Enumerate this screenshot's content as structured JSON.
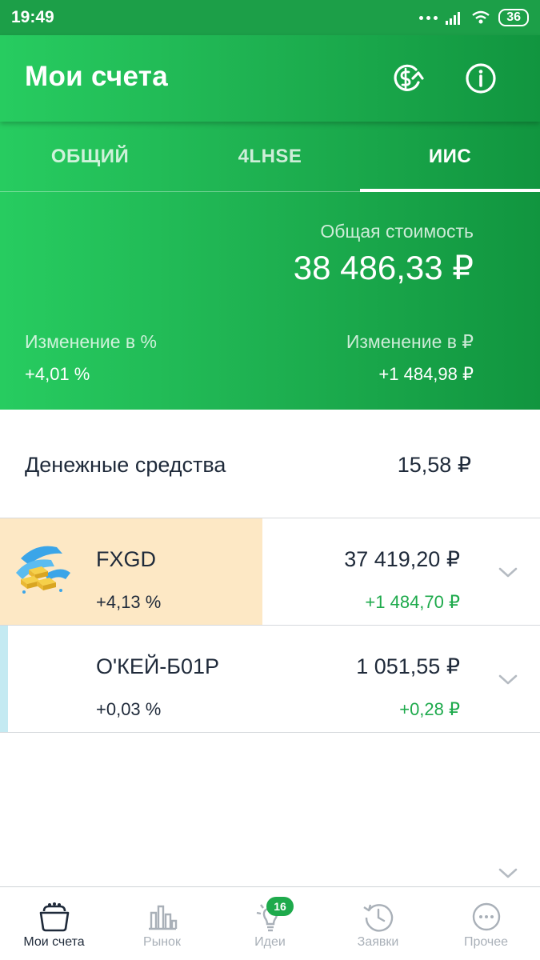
{
  "status_bar": {
    "time": "19:49",
    "battery": "36"
  },
  "header": {
    "title": "Мои счета",
    "icons": [
      "currency-exchange-icon",
      "info-icon"
    ]
  },
  "tabs": [
    {
      "label": "ОБЩИЙ",
      "selected": false
    },
    {
      "label": "4LHSE",
      "selected": false
    },
    {
      "label": "ИИС",
      "selected": true
    }
  ],
  "summary": {
    "total_label": "Общая стоимость",
    "total_value": "38 486,33 ₽",
    "change_pct_label": "Изменение в  %",
    "change_pct_value": "+4,01  %",
    "change_rub_label": "Изменение в ₽",
    "change_rub_value": "+1 484,98 ₽"
  },
  "cash": {
    "label": "Денежные средства",
    "value": "15,58 ₽"
  },
  "assets": [
    {
      "name": "FXGD",
      "pct": "+4,13  %",
      "value": "37 419,20 ₽",
      "change": "+1 484,70 ₽",
      "share": 0.486
    },
    {
      "name": "О'КЕЙ-Б01Р",
      "pct": "+0,03  %",
      "value": "1 051,55 ₽",
      "change": "+0,28 ₽",
      "share": 0.015
    }
  ],
  "bottom_nav": [
    {
      "label": "Мои счета",
      "icon": "wallet-icon",
      "active": true
    },
    {
      "label": "Рынок",
      "icon": "market-chart-icon",
      "active": false
    },
    {
      "label": "Идеи",
      "icon": "lightbulb-icon",
      "active": false,
      "badge": "16"
    },
    {
      "label": "Заявки",
      "icon": "clock-history-icon",
      "active": false
    },
    {
      "label": "Прочее",
      "icon": "more-dots-icon",
      "active": false
    }
  ],
  "colors": {
    "green_light": "#27cc60",
    "green_dark": "#11953f",
    "positive": "#1eaa4c",
    "gold_highlight": "#fde8c5",
    "blue_highlight": "#c4eaf2"
  }
}
